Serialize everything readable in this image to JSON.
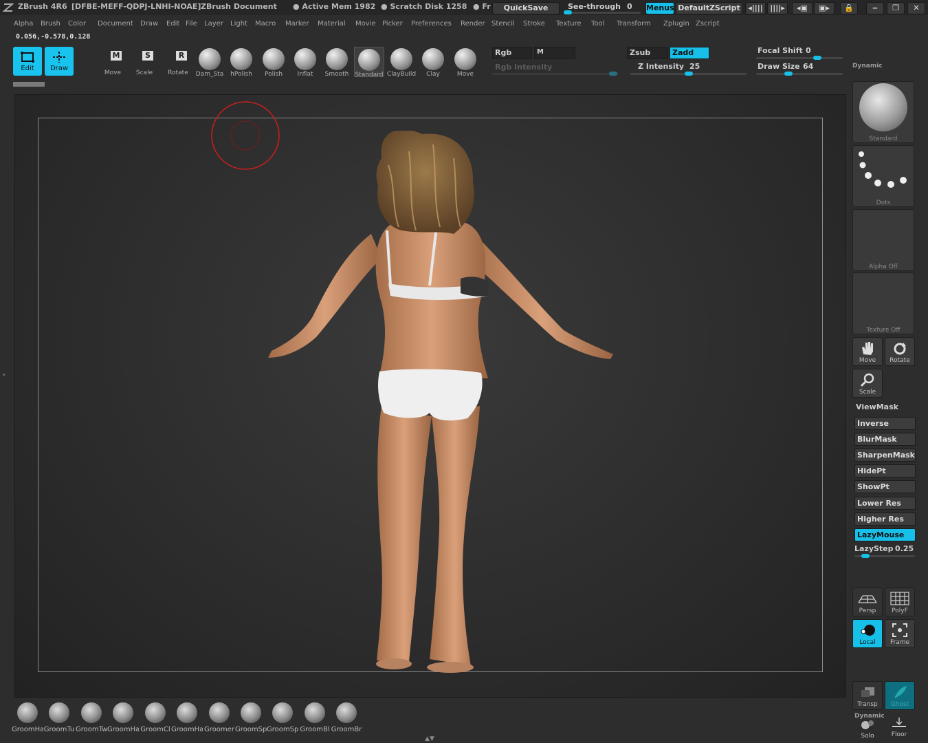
{
  "title": {
    "app": "ZBrush 4R6",
    "license": "[DFBE-MEFF-QDPJ-LNHI-NOAE]",
    "document": "ZBrush Document",
    "active_mem": "● Active Mem 1982",
    "scratch_disk": "● Scratch Disk 1258",
    "free": "● Fr",
    "quicksave": "QuickSave",
    "see_through": "See-through",
    "see_through_value": "0",
    "menus": "Menus",
    "script": "DefaultZScript"
  },
  "menubar": [
    "Alpha",
    "Brush",
    "Color",
    "Document",
    "Draw",
    "Edit",
    "File",
    "Layer",
    "Light",
    "Macro",
    "Marker",
    "Material",
    "Movie",
    "Picker",
    "Preferences",
    "Render",
    "Stencil",
    "Stroke",
    "Texture",
    "Tool",
    "Transform",
    "Zplugin",
    "Zscript"
  ],
  "coords": "0.056,-0.578,0.128",
  "toolbar": {
    "edit": "Edit",
    "draw": "Draw",
    "move": "Move",
    "scale": "Scale",
    "rotate": "Rotate",
    "brushes": [
      "Dam_Sta",
      "hPolish",
      "Polish",
      "Inflat",
      "Smooth",
      "Standard",
      "ClayBuild",
      "Clay",
      "Move"
    ],
    "rgb": "Rgb",
    "m": "M",
    "rgb_intensity": "Rgb  Intensity",
    "zsub": "Zsub",
    "zadd": "Zadd",
    "z_intensity_label": "Z  Intensity",
    "z_intensity": "25",
    "focal_shift_label": "Focal  Shift",
    "focal_shift": "0",
    "draw_size_label": "Draw  Size",
    "draw_size": "64",
    "dynamic": "Dynamic"
  },
  "right_panel": {
    "brush_thumb": "Standard",
    "stroke_thumb": "Dots",
    "alpha_thumb": "Alpha  Off",
    "texture_thumb": "Texture  Off",
    "move": "Move",
    "rotate": "Rotate",
    "scale": "Scale",
    "viewmask": "ViewMask",
    "buttons": [
      "Inverse",
      "BlurMask",
      "SharpenMask",
      "HidePt",
      "ShowPt",
      "Lower  Res",
      "Higher  Res",
      "LazyMouse"
    ],
    "lazystep_label": "LazyStep",
    "lazystep": "0.25",
    "persp": "Persp",
    "polyf": "PolyF",
    "local": "Local",
    "frame": "Frame",
    "transp": "Transp",
    "ghost": "Ghost",
    "dynamic": "Dynamic",
    "solo": "Solo",
    "floor": "Floor"
  },
  "groom_shelf": [
    "GroomHa",
    "GroomTu",
    "GroomTw",
    "GroomHa",
    "GroomCl",
    "GroomHa",
    "Groomer",
    "GroomSp",
    "GroomSp",
    "GroomBl",
    "GroomBr"
  ],
  "colors": {
    "accent": "#17c0e8",
    "cursor": "#cc1e1e",
    "skin": "#c9946f",
    "hair": "#8a6638"
  }
}
